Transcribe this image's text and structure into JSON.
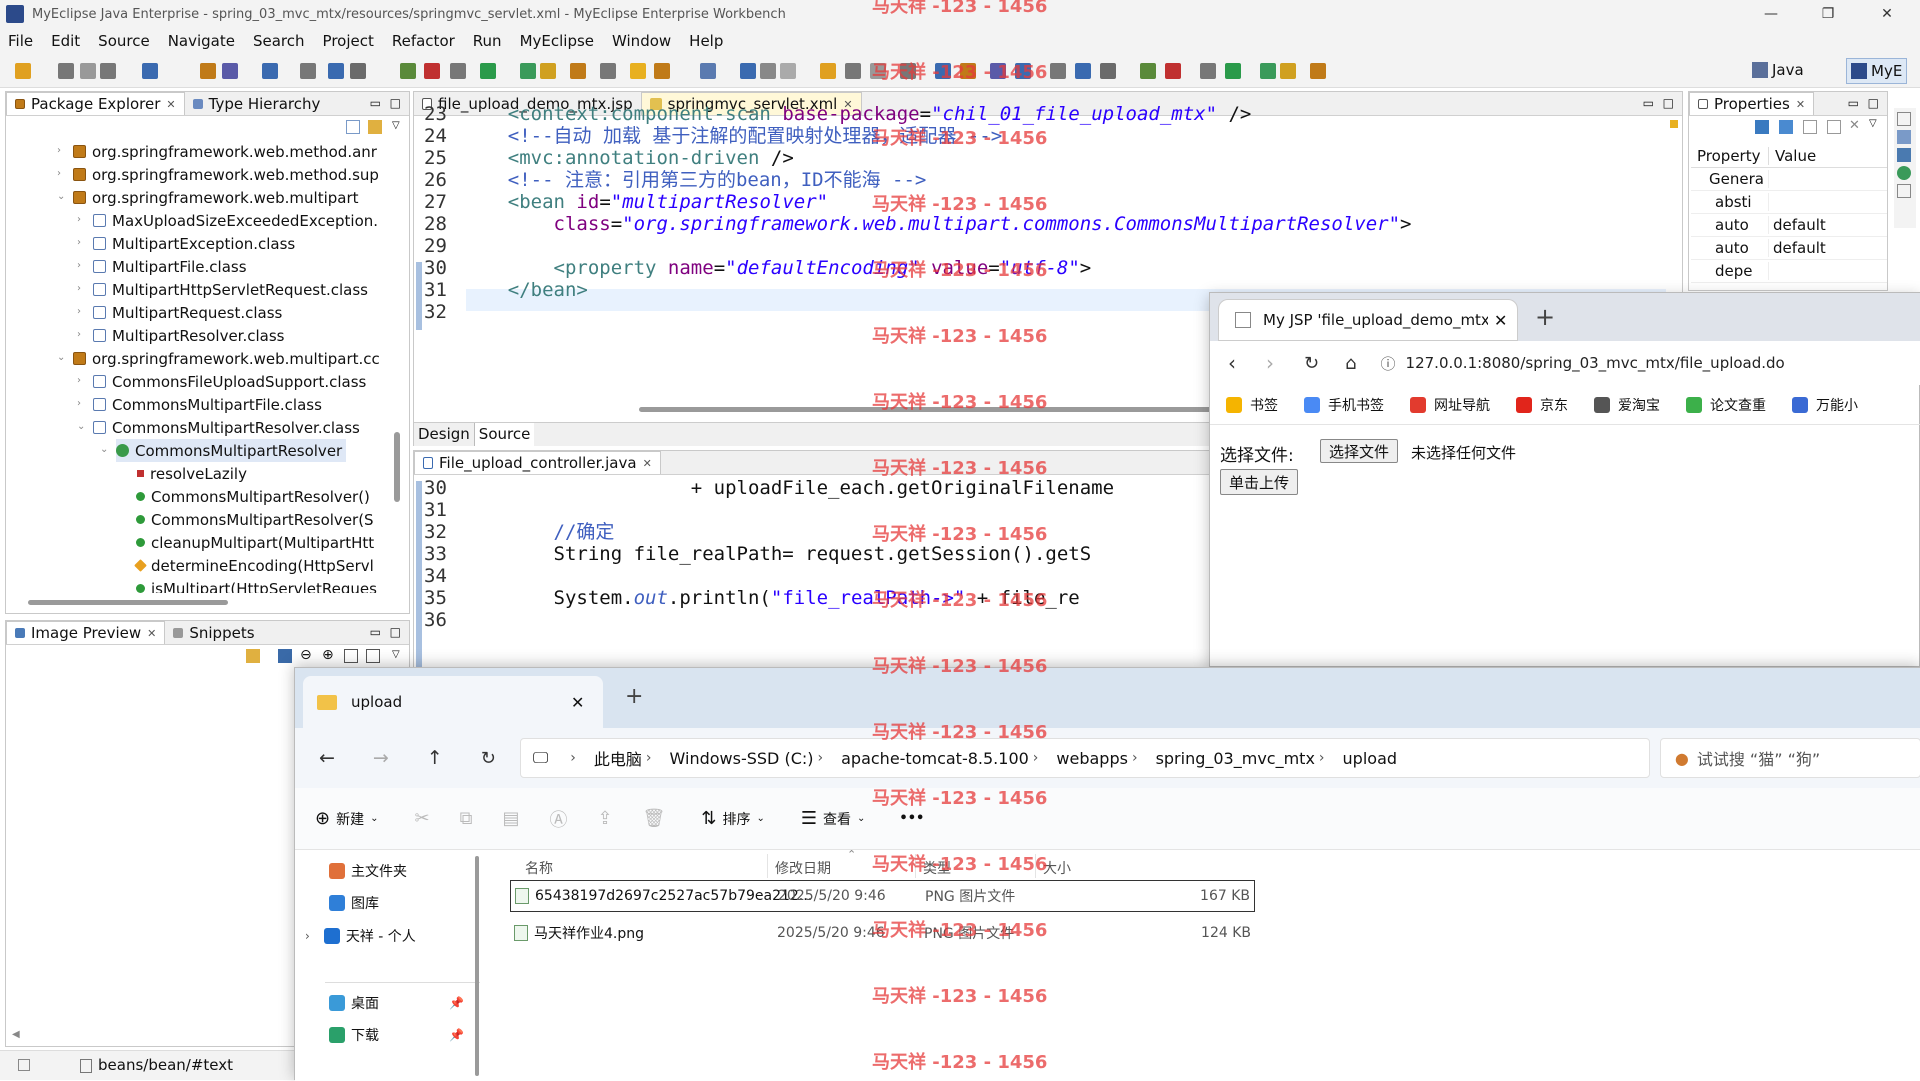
{
  "window": {
    "title": "MyEclipse Java Enterprise - spring_03_mvc_mtx/resources/springmvc_servlet.xml - MyEclipse Enterprise Workbench"
  },
  "menu": [
    "File",
    "Edit",
    "Source",
    "Navigate",
    "Search",
    "Project",
    "Refactor",
    "Run",
    "MyEclipse",
    "Window",
    "Help"
  ],
  "perspectives": {
    "java": "Java",
    "myeclipse": "MyE"
  },
  "package_explorer": {
    "tabs": [
      "Package Explorer",
      "Type Hierarchy"
    ],
    "rows": [
      {
        "text": "org.springframework.web.method.anr",
        "icon": "package-icon",
        "indent": 0,
        "arrow": ">"
      },
      {
        "text": "org.springframework.web.method.sup",
        "icon": "package-icon",
        "indent": 0,
        "arrow": ">"
      },
      {
        "text": "org.springframework.web.multipart",
        "icon": "package-icon",
        "indent": 0,
        "arrow": "v"
      },
      {
        "text": "MaxUploadSizeExceededException.",
        "icon": "class-file-icon",
        "indent": 1,
        "arrow": ">"
      },
      {
        "text": "MultipartException.class",
        "icon": "class-file-icon",
        "indent": 1,
        "arrow": ">"
      },
      {
        "text": "MultipartFile.class",
        "icon": "class-file-icon",
        "indent": 1,
        "arrow": ">"
      },
      {
        "text": "MultipartHttpServletRequest.class",
        "icon": "class-file-icon",
        "indent": 1,
        "arrow": ">"
      },
      {
        "text": "MultipartRequest.class",
        "icon": "class-file-icon",
        "indent": 1,
        "arrow": ">"
      },
      {
        "text": "MultipartResolver.class",
        "icon": "class-file-icon",
        "indent": 1,
        "arrow": ">"
      },
      {
        "text": "org.springframework.web.multipart.cc",
        "icon": "package-icon",
        "indent": 0,
        "arrow": "v"
      },
      {
        "text": "CommonsFileUploadSupport.class",
        "icon": "class-file-icon",
        "indent": 1,
        "arrow": ">"
      },
      {
        "text": "CommonsMultipartFile.class",
        "icon": "class-file-icon",
        "indent": 1,
        "arrow": ">"
      },
      {
        "text": "CommonsMultipartResolver.class",
        "icon": "class-file-icon",
        "indent": 1,
        "arrow": "v"
      },
      {
        "text": "CommonsMultipartResolver",
        "icon": "class-icon",
        "indent": 2,
        "arrow": "v",
        "selected": true
      },
      {
        "text": "resolveLazily",
        "icon": "field-icon",
        "indent": 3,
        "arrow": ""
      },
      {
        "text": "CommonsMultipartResolver()",
        "icon": "constructor-icon",
        "indent": 3,
        "arrow": ""
      },
      {
        "text": "CommonsMultipartResolver(S",
        "icon": "constructor-icon",
        "indent": 3,
        "arrow": ""
      },
      {
        "text": "cleanupMultipart(MultipartHtt",
        "icon": "method-icon",
        "indent": 3,
        "arrow": ""
      },
      {
        "text": "determineEncoding(HttpServl",
        "icon": "protected-method-icon",
        "indent": 3,
        "arrow": ""
      },
      {
        "text": "isMultipart(HttpServletReques",
        "icon": "method-icon",
        "indent": 3,
        "arrow": ""
      }
    ]
  },
  "image_preview": {
    "tabs": [
      "Image Preview",
      "Snippets"
    ]
  },
  "status": {
    "path": "beans/bean/#text"
  },
  "xml_editor": {
    "tabs": [
      "file_upload_demo_mtx.jsp",
      "springmvc_servlet.xml"
    ],
    "bottom_tabs": [
      "Design",
      "Source"
    ],
    "lines": [
      {
        "n": "23",
        "html": "    <span class='tag'>&lt;context:component-scan</span> <span class='attr'>base-package</span>=<span class='str'>\"chil_01_file_upload_mtx\"</span> /&gt;"
      },
      {
        "n": "24",
        "html": "    <span class='cm'>&lt;!--自动 加载 基于注解的配置映射处理器，适配器 --&gt;</span>"
      },
      {
        "n": "25",
        "html": "    <span class='tag'>&lt;mvc:annotation-driven</span> /&gt;"
      },
      {
        "n": "26",
        "html": "    <span class='cm'>&lt;!-- 注意：引用第三方的bean，ID不能海 --&gt;</span>"
      },
      {
        "n": "27",
        "html": "    <span class='tag'>&lt;bean</span> <span class='attr'>id</span>=<span class='str'>\"multipartResolver\"</span>"
      },
      {
        "n": "28",
        "html": "        <span class='attr'>class</span>=<span class='str'>\"org.springframework.web.multipart.commons.CommonsMultipartResolver\"</span>&gt;"
      },
      {
        "n": "29",
        "html": ""
      },
      {
        "n": "30",
        "html": "        <span class='tag'>&lt;property</span> <span class='attr'>name</span>=<span class='str'>\"defaultEncoding\"</span> <span class='attr'>value</span>=<span class='str'>\"utf-8\"</span>&gt;"
      },
      {
        "n": "31",
        "html": "    <span class='tag'>&lt;/bean&gt;</span>"
      },
      {
        "n": "32",
        "html": ""
      }
    ]
  },
  "java_editor": {
    "tab": "File_upload_controller.java",
    "lines": [
      {
        "n": "30",
        "html": "                    + uploadFile_each.getOriginalFilename"
      },
      {
        "n": "31",
        "html": ""
      },
      {
        "n": "32",
        "html": "        <span class='cm'>//确定</span>"
      },
      {
        "n": "33",
        "html": "        String file_realPath= request.getSession().getS"
      },
      {
        "n": "34",
        "html": ""
      },
      {
        "n": "35",
        "html": "        System.<span class='kw' style='font-style:italic'>out</span>.println(<span class='str' style='font-style:normal'>\"file_realPath-&gt;\"</span> + file_re"
      },
      {
        "n": "36",
        "html": ""
      }
    ]
  },
  "properties": {
    "tab": "Properties",
    "headers": [
      "Property",
      "Value"
    ],
    "rows": [
      {
        "p": "Genera",
        "v": ""
      },
      {
        "p": "absti",
        "v": ""
      },
      {
        "p": "auto",
        "v": "default"
      },
      {
        "p": "auto",
        "v": "default"
      },
      {
        "p": "depe",
        "v": ""
      }
    ]
  },
  "browser": {
    "tab_title": "My JSP 'file_upload_demo_mtx.",
    "url": "127.0.0.1:8080/spring_03_mvc_mtx/file_upload.do",
    "bookmarks": [
      {
        "label": "书签",
        "color": "#f5b400"
      },
      {
        "label": "手机书签",
        "color": "#4a8af4"
      },
      {
        "label": "网址导航",
        "color": "#e23b2e"
      },
      {
        "label": "京东",
        "color": "#e1251b"
      },
      {
        "label": "爱淘宝",
        "color": "#555555"
      },
      {
        "label": "论文查重",
        "color": "#3cb04a"
      },
      {
        "label": "万能小",
        "color": "#3a6ad4"
      }
    ],
    "form": {
      "label": "选择文件:",
      "choose_button": "选择文件",
      "no_file": "未选择任何文件",
      "upload_button": "单击上传"
    }
  },
  "explorer": {
    "tab_title": "upload",
    "breadcrumb": [
      "此电脑",
      "Windows-SSD (C:)",
      "apache-tomcat-8.5.100",
      "webapps",
      "spring_03_mvc_mtx",
      "upload"
    ],
    "search_placeholder": "试试搜 “猫” “狗”",
    "commands": {
      "new": "新建",
      "sort": "排序",
      "view": "查看",
      "more": "•••"
    },
    "sidebar": [
      {
        "label": "主文件夹",
        "icon": "home-icon",
        "color": "#e0703a"
      },
      {
        "label": "图库",
        "icon": "gallery-icon",
        "color": "#2f7fd8"
      },
      {
        "label": "天祥 - 个人",
        "icon": "onedrive-icon",
        "color": "#1e6fd0"
      },
      {
        "label": "桌面",
        "icon": "desktop-icon",
        "color": "#3a9ad8"
      },
      {
        "label": "下载",
        "icon": "download-icon",
        "color": "#2aa06a"
      }
    ],
    "columns": [
      "名称",
      "修改日期",
      "类型",
      "大小"
    ],
    "files": [
      {
        "name": "65438197d2697c2527ac57b79ea212...",
        "date": "2025/5/20 9:46",
        "type": "PNG 图片文件",
        "size": "167 KB",
        "selected": true
      },
      {
        "name": "马天祥作业4.png",
        "date": "2025/5/20 9:46",
        "type": "PNG 图片文件",
        "size": "124 KB",
        "selected": false
      }
    ]
  },
  "watermark": "马天祥 -123 - 1456"
}
